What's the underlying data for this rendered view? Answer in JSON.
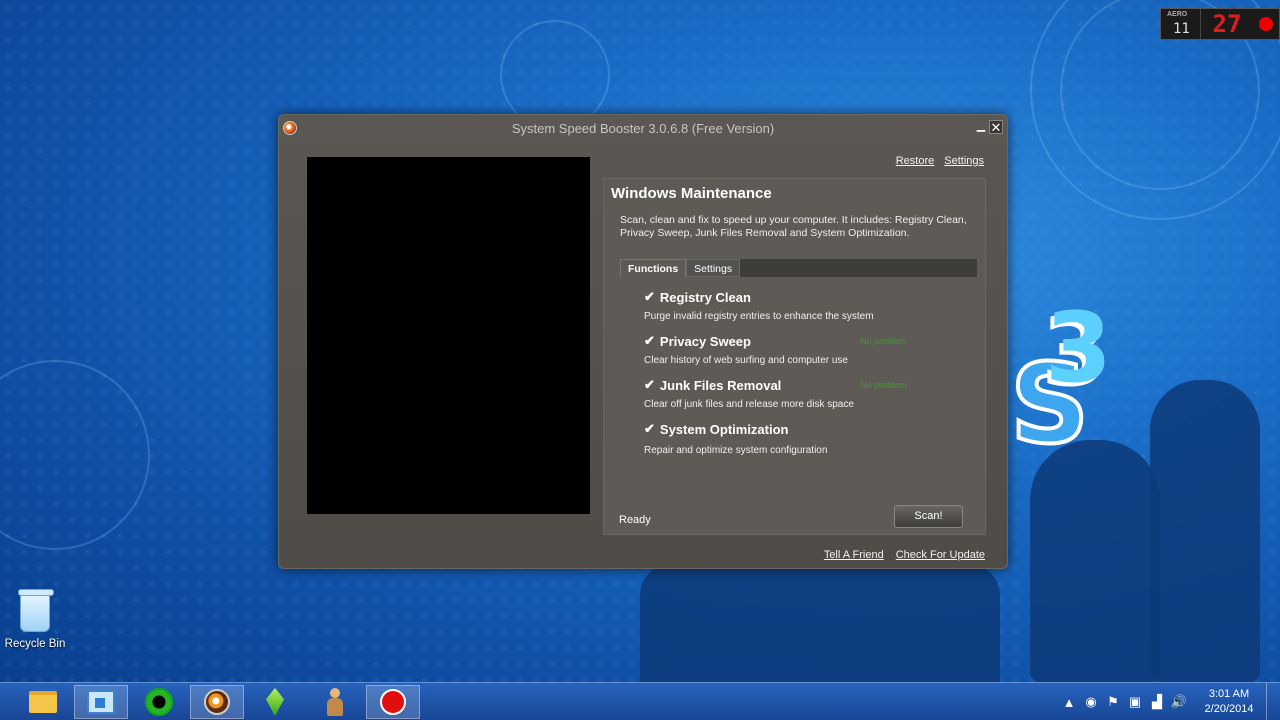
{
  "window": {
    "title": "System Speed Booster  3.0.6.8  (Free Version)",
    "minimize_icon": "minimize-icon",
    "close_icon": "close-icon"
  },
  "top_links": {
    "restore": "Restore",
    "settings": "Settings"
  },
  "panel": {
    "heading": "Windows Maintenance",
    "description": "Scan, clean and fix to speed up your computer. It includes: Registry Clean, Privacy Sweep, Junk Files Removal and System Optimization.",
    "tabs": [
      {
        "label": "Functions",
        "active": true
      },
      {
        "label": "Settings",
        "active": false
      }
    ],
    "functions": [
      {
        "checked": true,
        "title": "Registry Clean",
        "desc": "Purge invalid registry entries to enhance the system",
        "status": ""
      },
      {
        "checked": true,
        "title": "Privacy Sweep",
        "desc": "Clear history of web surfing and computer use",
        "status": "No problem"
      },
      {
        "checked": true,
        "title": "Junk Files Removal",
        "desc": "Clear off junk files and release more disk space",
        "status": "No problem"
      },
      {
        "checked": true,
        "title": "System Optimization",
        "desc": "Repair and optimize system configuration",
        "status": ""
      }
    ],
    "status": "Ready",
    "scan_button": "Scan!"
  },
  "bottom_links": {
    "tell_friend": "Tell A Friend",
    "check_update": "Check For Update"
  },
  "desktop": {
    "recycle_bin_label": "Recycle Bin",
    "game_logo_text": "3"
  },
  "recorder_widget": {
    "aero_label": "AERO",
    "aero_value": "11",
    "frame_count": "27"
  },
  "taskbar": {
    "apps": [
      "file-explorer-icon",
      "remote-desktop-icon",
      "green-app-icon",
      "system-speed-booster-icon",
      "sims-gem-icon",
      "person-app-icon",
      "record-icon"
    ],
    "clock_time": "3:01 AM",
    "clock_date": "2/20/2014"
  },
  "colors": {
    "desktop_bg": "#1a6cc6",
    "window_bg": "#55524e",
    "status_ok": "#3f9a2c",
    "recorder_red": "#e21b1b"
  }
}
